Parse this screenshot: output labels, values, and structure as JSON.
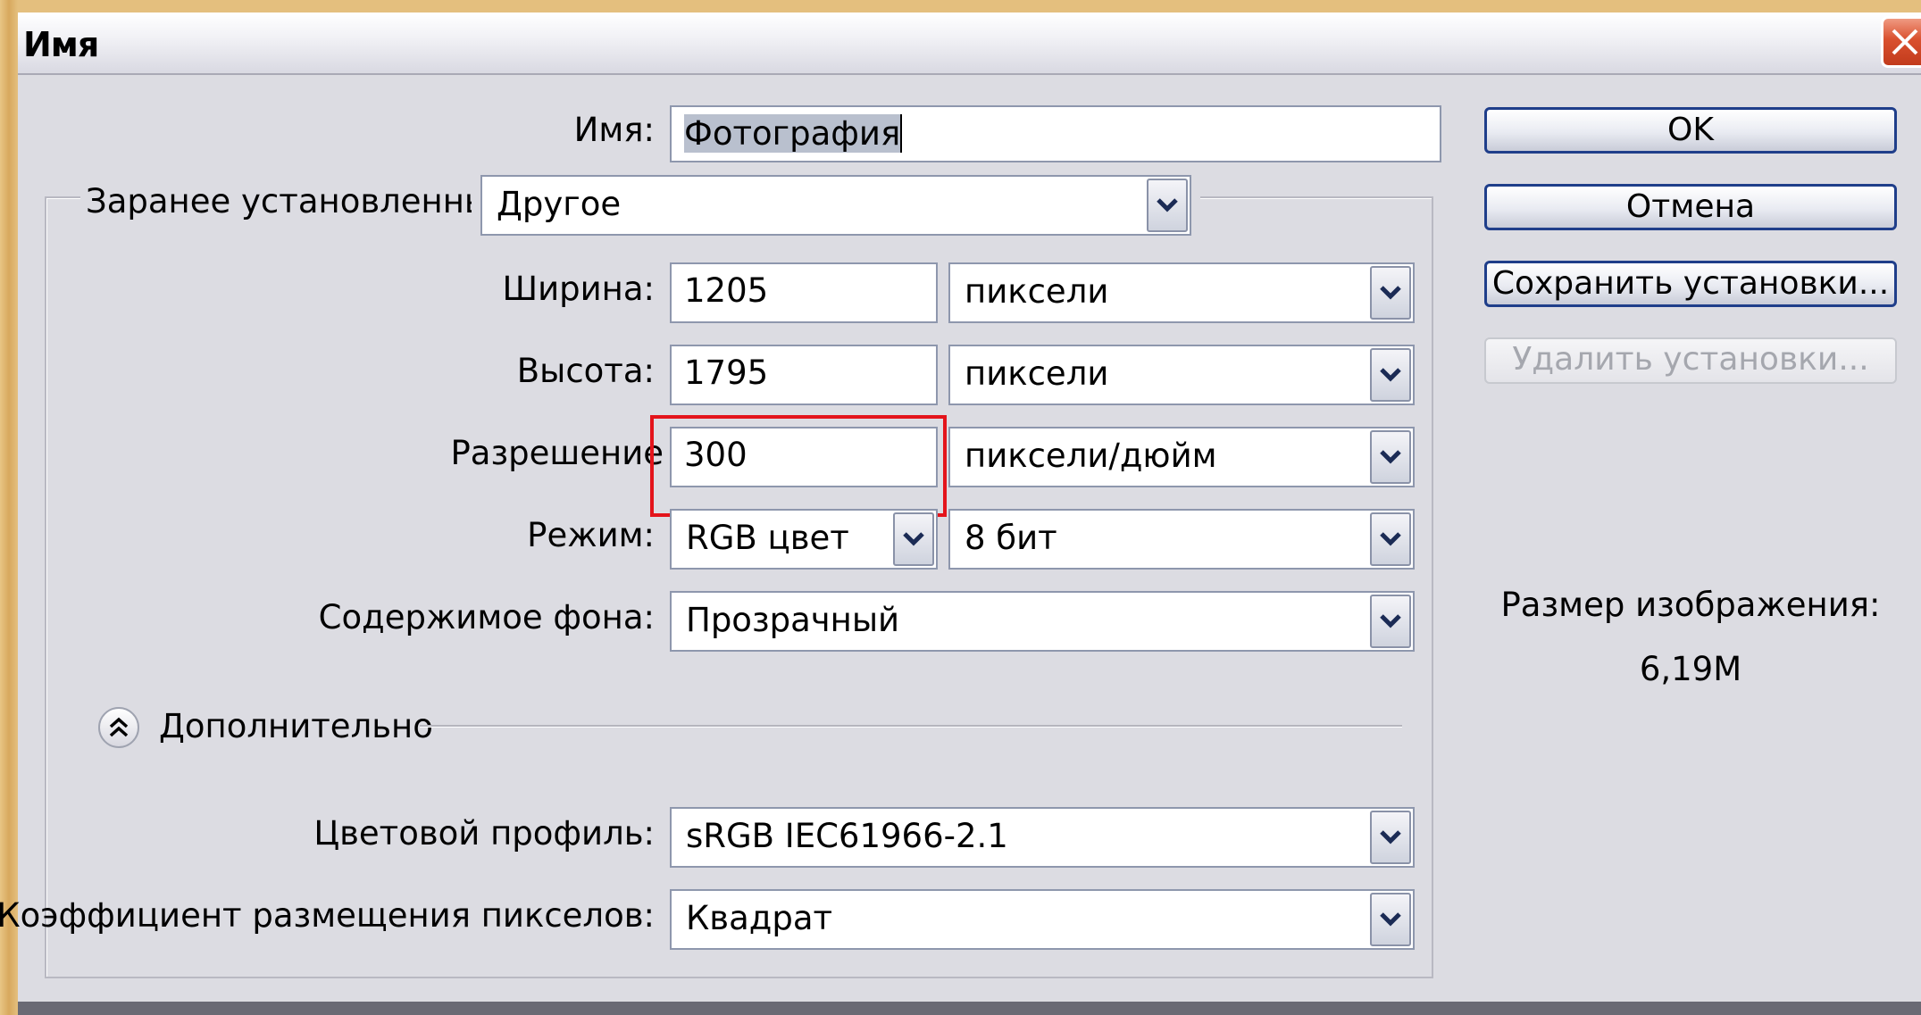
{
  "window": {
    "title": "Имя"
  },
  "name": {
    "label": "Имя:",
    "value": "Фотография"
  },
  "preset": {
    "label": "Заранее установленные:",
    "value": "Другое"
  },
  "width": {
    "label": "Ширина:",
    "value": "1205",
    "unit": "пиксели"
  },
  "height": {
    "label": "Высота:",
    "value": "1795",
    "unit": "пиксели"
  },
  "resolution": {
    "label": "Разрешение",
    "value": "300",
    "unit": "пиксели/дюйм"
  },
  "mode": {
    "label": "Режим:",
    "value": "RGB цвет",
    "depth": "8 бит"
  },
  "background": {
    "label": "Содержимое фона:",
    "value": "Прозрачный"
  },
  "advanced": {
    "label": "Дополнительно"
  },
  "color_profile": {
    "label": "Цветовой профиль:",
    "value": "sRGB IEC61966-2.1"
  },
  "pixel_aspect": {
    "label": "Коэффициент размещения пикселов:",
    "value": "Квадрат"
  },
  "buttons": {
    "ok": "OK",
    "cancel": "Отмена",
    "save_preset": "Сохранить установки...",
    "delete_preset": "Удалить установки..."
  },
  "image_size": {
    "label": "Размер изображения:",
    "value": "6,19M"
  },
  "colors": {
    "highlight": "#e4141b",
    "button_border": "#1f3e8a",
    "close": "#d9502e"
  },
  "icons": {
    "close": "close-x-icon",
    "dropdown": "chevron-down-icon",
    "expander": "double-chevron-up-icon"
  }
}
